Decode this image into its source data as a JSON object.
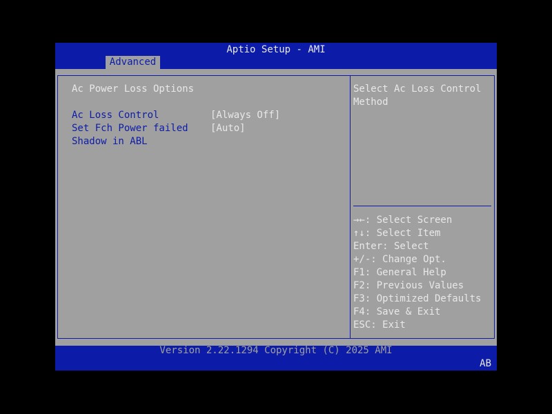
{
  "header": {
    "title": "Aptio Setup - AMI",
    "active_tab": "Advanced"
  },
  "page": {
    "heading": "Ac Power Loss Options",
    "items": [
      {
        "label": "Ac Loss Control",
        "value": "[Always Off]"
      },
      {
        "label": "Set Fch Power failed",
        "value": "[Auto]"
      },
      {
        "label": "Shadow in ABL",
        "value": ""
      }
    ]
  },
  "help": {
    "description": "Select Ac Loss Control Method",
    "keys": [
      "→←: Select Screen",
      "↑↓: Select Item",
      "Enter: Select",
      "+/-: Change Opt.",
      "F1: General Help",
      "F2: Previous Values",
      "F3: Optimized Defaults",
      "F4: Save & Exit",
      "ESC: Exit"
    ]
  },
  "footer": {
    "version": "Version 2.22.1294 Copyright (C) 2025 AMI",
    "badge": "AB"
  },
  "colors": {
    "bios_blue": "#0C1CA8",
    "panel_gray": "#A0A0A0",
    "text_white": "#E8E8E8",
    "background": "#000000"
  }
}
